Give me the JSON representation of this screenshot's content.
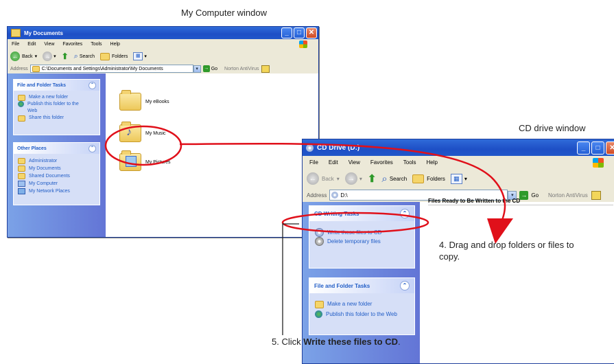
{
  "captions": {
    "left_window": "My Computer window",
    "right_window": "CD drive window",
    "step4": "4. Drag and drop folders or files to copy.",
    "step5_prefix": "5. Click ",
    "step5_bold": "Write these files to CD",
    "step5_suffix": "."
  },
  "mydocs": {
    "title": "My Documents",
    "menu": [
      "File",
      "Edit",
      "View",
      "Favorites",
      "Tools",
      "Help"
    ],
    "toolbar": {
      "back": "Back",
      "search": "Search",
      "folders": "Folders"
    },
    "address_label": "Address",
    "address_value": "C:\\Documents and Settings\\Administrator\\My Documents",
    "go": "Go",
    "norton": "Norton AntiVirus",
    "panels": [
      {
        "title": "File and Folder Tasks",
        "items": [
          "Make a new folder",
          "Publish this folder to the Web",
          "Share this folder"
        ]
      },
      {
        "title": "Other Places",
        "items": [
          "Administrator",
          "My Documents",
          "Shared Documents",
          "My Computer",
          "My Network Places"
        ]
      }
    ],
    "folders": [
      "My eBooks",
      "My Music",
      "My Pictures"
    ]
  },
  "cddrive": {
    "title": "CD Drive (D:)",
    "menu": [
      "File",
      "Edit",
      "View",
      "Favorites",
      "Tools",
      "Help"
    ],
    "toolbar": {
      "back": "Back",
      "search": "Search",
      "folders": "Folders"
    },
    "address_label": "Address",
    "address_value": "D:\\",
    "go": "Go",
    "norton": "Norton AntiVirus",
    "content_header": "Files Ready to Be Written to the CD",
    "panels": [
      {
        "title": "CD Writing Tasks",
        "items": [
          "Write these files to CD",
          "Delete temporary files"
        ]
      },
      {
        "title": "File and Folder Tasks",
        "items": [
          "Make a new folder",
          "Publish this folder to the Web"
        ]
      }
    ]
  },
  "colors": {
    "annotation": "#e0101a",
    "xp_blue": "#215dc6",
    "titlebar": "#2457cc"
  }
}
